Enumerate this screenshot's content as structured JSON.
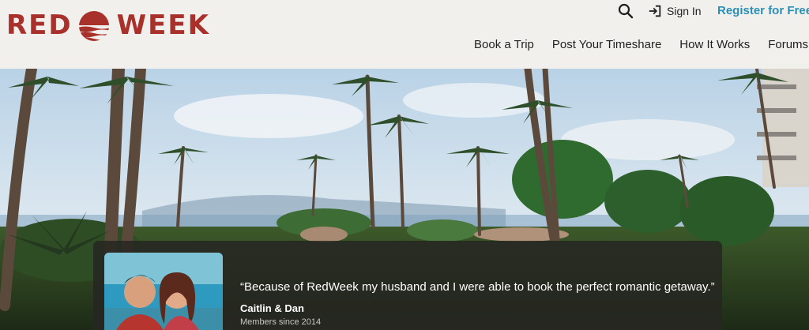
{
  "brand": {
    "left_word": "RED",
    "right_word": "WEEK",
    "color": "#a8322b"
  },
  "utility": {
    "search_icon": "search-icon",
    "signin_icon": "signin-arrow-icon",
    "signin_label": "Sign In",
    "register_label": "Register for Free!",
    "register_color": "#2a8fb4"
  },
  "nav": {
    "items": [
      {
        "label": "Book a Trip"
      },
      {
        "label": "Post Your Timeshare"
      },
      {
        "label": "How It Works"
      },
      {
        "label": "Forums"
      }
    ]
  },
  "testimonial": {
    "quote": "“Because of RedWeek my husband and I were able to book the perfect romantic getaway.”",
    "names": "Caitlin & Dan",
    "since": "Members since 2014"
  }
}
